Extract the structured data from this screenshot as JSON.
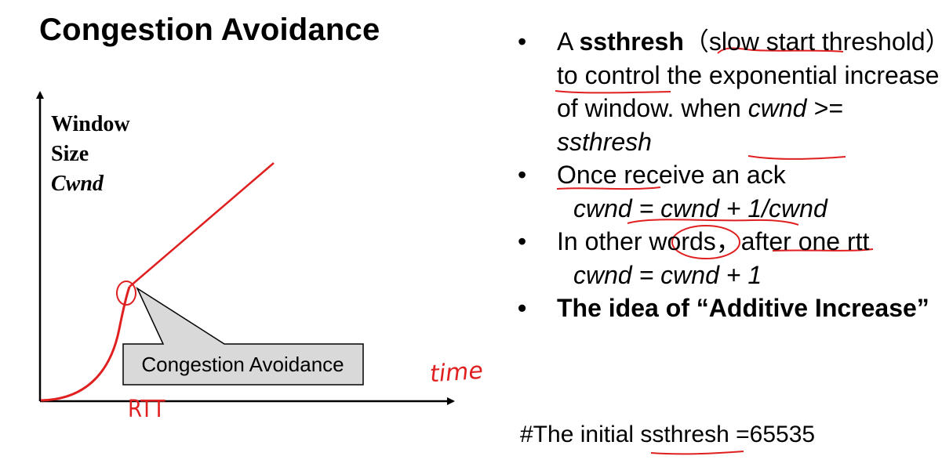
{
  "title": "Congestion Avoidance",
  "diagram": {
    "y_axis_label": {
      "line1": "Window",
      "line2": "Size",
      "line3": "Cwnd"
    },
    "callout_label": "Congestion Avoidance",
    "annotation_time": "time",
    "annotation_rtt": "RTT",
    "colors": {
      "curve": "#e02020",
      "axis": "#000000",
      "callout_fill": "#d9d9d9",
      "ink": "#e02020"
    }
  },
  "bullets": [
    {
      "prefix": "A ",
      "bold": "ssthresh",
      "text1": "（slow start threshold）to control the exponential increase of window.  when ",
      "italic": "cwnd >= ssthresh"
    },
    {
      "text": "Once receive an ack",
      "formula": "cwnd = cwnd + 1/cwnd"
    },
    {
      "text": "In other words，after one rtt",
      "formula": "cwnd = cwnd + 1"
    },
    {
      "bold": "The idea of “Additive Increase”"
    }
  ],
  "footer": "#The initial ssthresh =65535"
}
